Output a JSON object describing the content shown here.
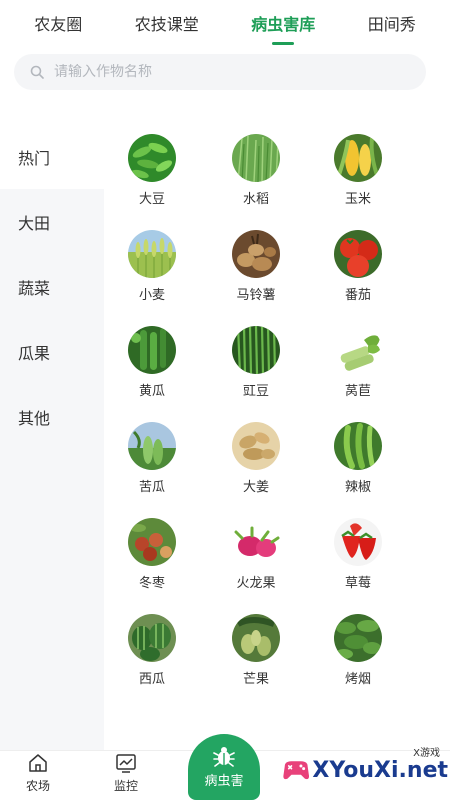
{
  "top_tabs": [
    {
      "label": "农友圈"
    },
    {
      "label": "农技课堂"
    },
    {
      "label": "病虫害库"
    },
    {
      "label": "田间秀"
    }
  ],
  "active_tab": "病虫害库",
  "search": {
    "placeholder": "请输入作物名称"
  },
  "sidebar": {
    "items": [
      {
        "label": "热门"
      },
      {
        "label": "大田"
      },
      {
        "label": "蔬菜"
      },
      {
        "label": "瓜果"
      },
      {
        "label": "其他"
      }
    ],
    "active": "热门"
  },
  "crops": [
    {
      "label": "大豆",
      "icon": "soybean-image"
    },
    {
      "label": "水稻",
      "icon": "rice-image"
    },
    {
      "label": "玉米",
      "icon": "corn-image"
    },
    {
      "label": "小麦",
      "icon": "wheat-image"
    },
    {
      "label": "马铃薯",
      "icon": "potato-image"
    },
    {
      "label": "番茄",
      "icon": "tomato-image"
    },
    {
      "label": "黄瓜",
      "icon": "cucumber-image"
    },
    {
      "label": "豇豆",
      "icon": "cowpea-image"
    },
    {
      "label": "莴苣",
      "icon": "lettuce-image"
    },
    {
      "label": "苦瓜",
      "icon": "bitter-gourd-image"
    },
    {
      "label": "大姜",
      "icon": "ginger-image"
    },
    {
      "label": "辣椒",
      "icon": "pepper-image"
    },
    {
      "label": "冬枣",
      "icon": "jujube-image"
    },
    {
      "label": "火龙果",
      "icon": "dragon-fruit-image"
    },
    {
      "label": "草莓",
      "icon": "strawberry-image"
    },
    {
      "label": "西瓜",
      "icon": "watermelon-image"
    },
    {
      "label": "芒果",
      "icon": "mango-image"
    },
    {
      "label": "烤烟",
      "icon": "tobacco-image"
    }
  ],
  "bottom_nav": {
    "farm_label": "农场",
    "monitor_label": "监控",
    "pest_label": "病虫害"
  },
  "watermark": {
    "text": "XYouXi.net",
    "small": "X游戏"
  },
  "colors": {
    "accent": "#1e9e57",
    "center_button": "#23a562"
  }
}
